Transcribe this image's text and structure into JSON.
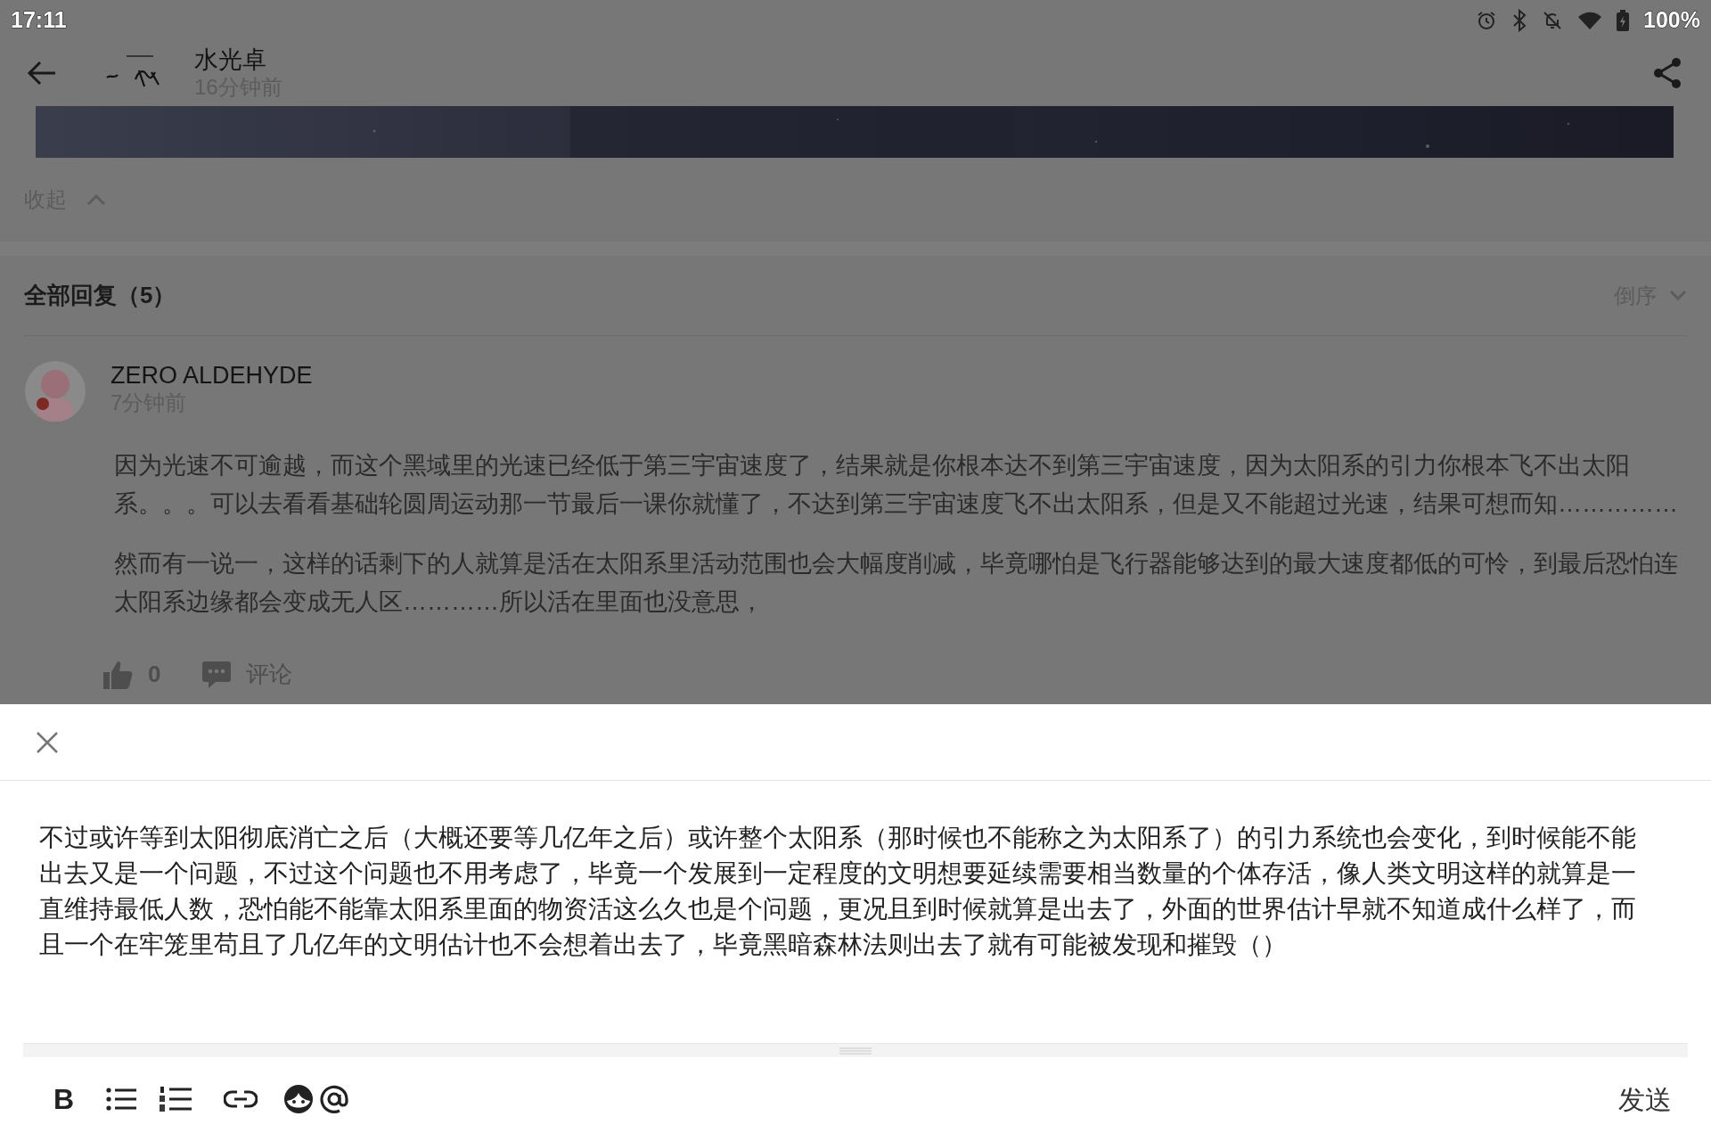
{
  "status_bar": {
    "time": "17:11",
    "battery": "100%"
  },
  "post": {
    "author": "水光卓",
    "time": "16分钟前",
    "collapse": "收起"
  },
  "replies_header": {
    "title": "全部回复（5）",
    "sort": "倒序"
  },
  "comments": [
    {
      "author": "ZERO ALDEHYDE",
      "time": "7分钟前",
      "paragraphs": [
        "因为光速不可逾越，而这个黑域里的光速已经低于第三宇宙速度了，结果就是你根本达不到第三宇宙速度，因为太阳系的引力你根本飞不出太阳系。。。可以去看看基础轮圆周运动那一节最后一课你就懂了，不达到第三宇宙速度飞不出太阳系，但是又不能超过光速，结果可想而知……………",
        "然而有一说一，这样的话剩下的人就算是活在太阳系里活动范围也会大幅度削减，毕竟哪怕是飞行器能够达到的最大速度都低的可怜，到最后恐怕连太阳系边缘都会变成无人区…………所以活在里面也没意思，"
      ],
      "likes": "0",
      "comment_label": "评论"
    }
  ],
  "composer": {
    "value": "不过或许等到太阳彻底消亡之后（大概还要等几亿年之后）或许整个太阳系（那时候也不能称之为太阳系了）的引力系统也会变化，到时候能不能出去又是一个问题，不过这个问题也不用考虑了，毕竟一个发展到一定程度的文明想要延续需要相当数量的个体存活，像人类文明这样的就算是一直维持最低人数，恐怕能不能靠太阳系里面的物资活这么久也是个问题，更况且到时候就算是出去了，外面的世界估计早就不知道成什么样了，而且一个在牢笼里苟且了几亿年的文明估计也不会想着出去了，毕竟黑暗森林法则出去了就有可能被发现和摧毁（）",
    "bold_key": "B",
    "send": "发送"
  }
}
